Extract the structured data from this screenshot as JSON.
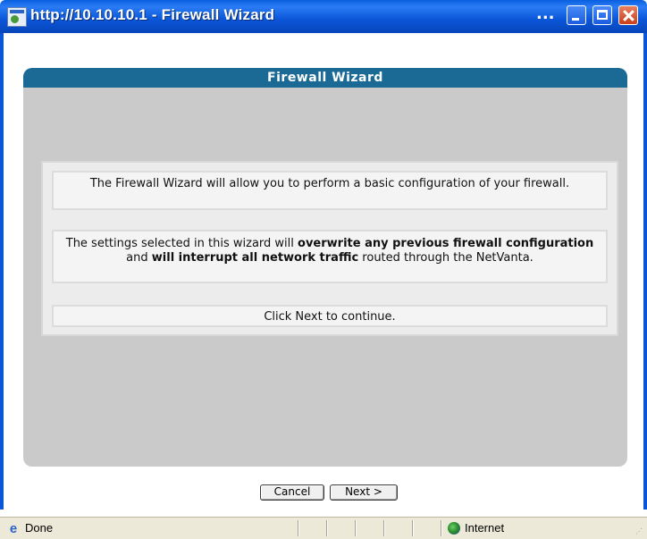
{
  "window": {
    "title": "http://10.10.10.1 - Firewall Wizard",
    "title_overflow": "..."
  },
  "panel": {
    "header": "Firewall Wizard",
    "message1": "The Firewall Wizard will allow you to perform a basic configuration of your firewall.",
    "message2": {
      "part1": "The settings selected in this wizard will ",
      "bold1": "overwrite any previous firewall configuration",
      "part2": " and ",
      "bold2": "will interrupt all network traffic",
      "part3": " routed through the NetVanta."
    },
    "message3": "Click Next to continue."
  },
  "buttons": {
    "cancel": "Cancel",
    "next": "Next >"
  },
  "statusbar": {
    "status": "Done",
    "zone": "Internet"
  },
  "icons": {
    "window": "ie-window-icon",
    "status": "ie-page-icon",
    "zone": "internet-globe-icon"
  },
  "colors": {
    "titlebar": "#0a55d8",
    "panel_header": "#1b6a96",
    "panel_bg": "#cacaca"
  }
}
